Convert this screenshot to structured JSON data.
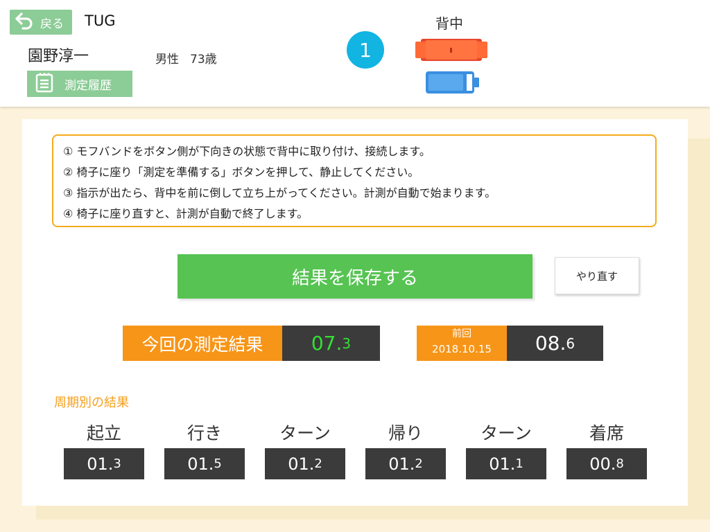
{
  "header": {
    "back_label": "戻る",
    "test_name": "TUG",
    "patient_name": "園野淳一",
    "gender": "男性",
    "age": "73歳",
    "history_label": "測定履歴",
    "device_number": "1",
    "sensor_position": "背中",
    "icons": [
      "back-arrow-icon",
      "clipboard-icon",
      "band-sensor-icon",
      "battery-icon"
    ]
  },
  "instructions": [
    "① モフバンドをボタン側が下向きの状態で背中に取り付け、接続します。",
    "② 椅子に座り「測定を準備する」ボタンを押して、静止してください。",
    "③ 指示が出たら、背中を前に倒して立ち上がってください。計測が自動で始まります。",
    "④ 椅子に座り直すと、計測が自動で終了します。"
  ],
  "actions": {
    "save_label": "結果を保存する",
    "redo_label": "やり直す"
  },
  "result": {
    "current_label": "今回の測定結果",
    "current_int": "07.",
    "current_dec": "3",
    "previous_label": "前回",
    "previous_date": "2018.10.15",
    "previous_int": "08.",
    "previous_dec": "6"
  },
  "phases": {
    "title": "周期別の結果",
    "items": [
      {
        "label": "起立",
        "int": "01.",
        "dec": "3"
      },
      {
        "label": "行き",
        "int": "01.",
        "dec": "5"
      },
      {
        "label": "ターン",
        "int": "01.",
        "dec": "2"
      },
      {
        "label": "帰り",
        "int": "01.",
        "dec": "2"
      },
      {
        "label": "ターン",
        "int": "01.",
        "dec": "1"
      },
      {
        "label": "着席",
        "int": "00.",
        "dec": "8"
      }
    ]
  },
  "colors": {
    "accent_green": "#56c352",
    "button_green": "#8ccc96",
    "orange": "#f79518",
    "cyan": "#12b4e2",
    "dark": "#3b3b3b",
    "value_green": "#33e033",
    "background": "#fdf3dc"
  }
}
